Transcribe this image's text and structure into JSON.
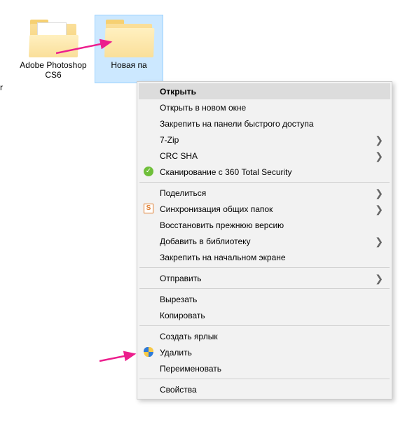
{
  "desktop": {
    "edge_label": "r",
    "items": [
      {
        "label": "Adobe Photoshop CS6"
      },
      {
        "label": "Новая па"
      }
    ]
  },
  "context_menu": {
    "open": "Открыть",
    "open_new_window": "Открыть в новом окне",
    "pin_quick_access": "Закрепить на панели быстрого доступа",
    "seven_zip": "7-Zip",
    "crc_sha": "CRC SHA",
    "scan_360": "Сканирование с 360 Total Security",
    "share": "Поделиться",
    "sync_shared": "Синхронизация общих папок",
    "restore_previous": "Восстановить прежнюю версию",
    "add_to_library": "Добавить в библиотеку",
    "pin_start": "Закрепить на начальном экране",
    "send_to": "Отправить",
    "cut": "Вырезать",
    "copy": "Копировать",
    "create_shortcut": "Создать ярлык",
    "delete": "Удалить",
    "rename": "Переименовать",
    "properties": "Свойства"
  }
}
